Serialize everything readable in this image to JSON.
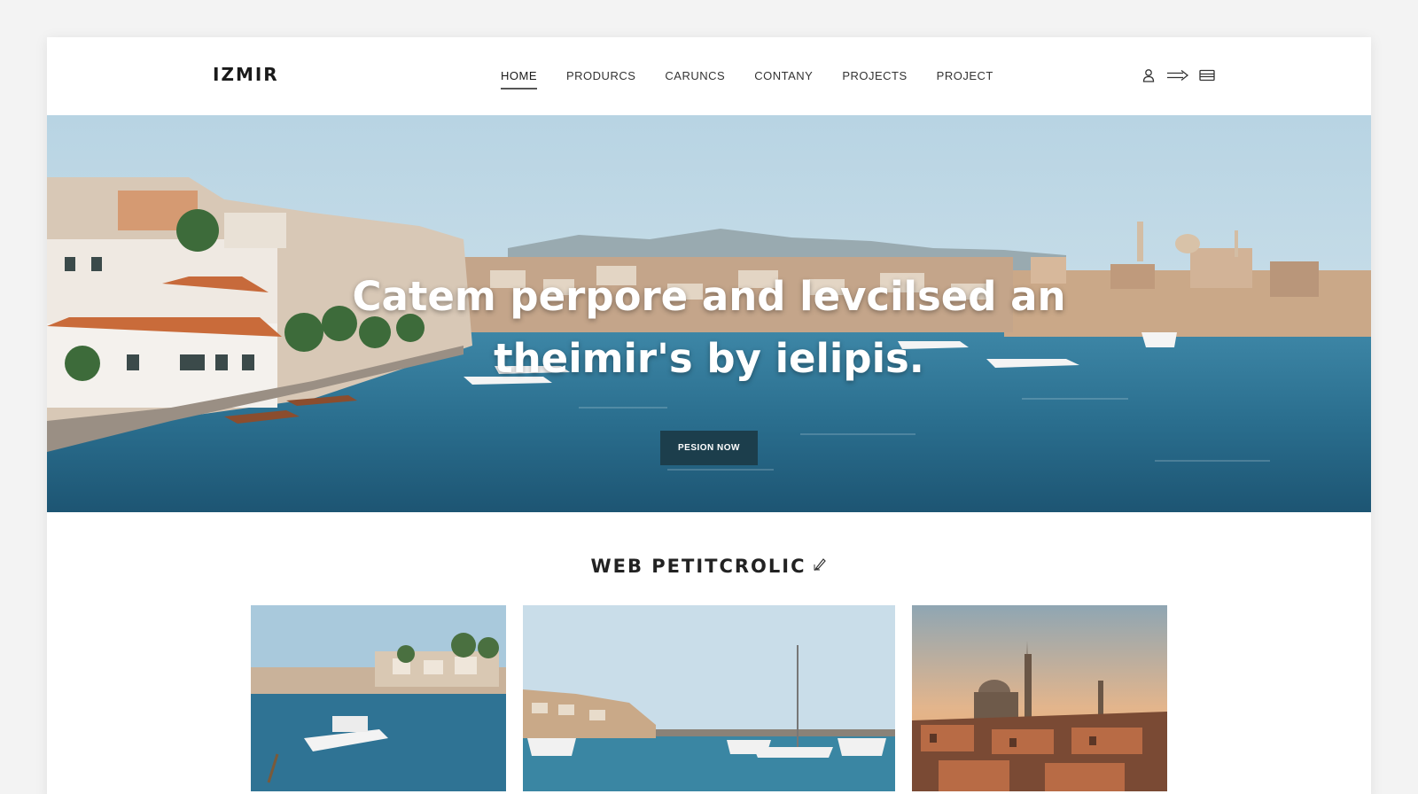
{
  "header": {
    "logo": "IZMIR",
    "nav": [
      {
        "label": "HOME",
        "active": true
      },
      {
        "label": "PRODURCS",
        "active": false
      },
      {
        "label": "CARUNCS",
        "active": false
      },
      {
        "label": "CONTANY",
        "active": false
      },
      {
        "label": "PROJECTS",
        "active": false
      },
      {
        "label": "PROJECT",
        "active": false
      }
    ],
    "icons": [
      "user-icon",
      "arrow-right-icon",
      "card-icon"
    ]
  },
  "hero": {
    "title_line1": "Catem perpore and levcilsed an",
    "title_line2": "theimir's by ielipis.",
    "cta_label": "PESION NOW"
  },
  "section": {
    "title": "WEB PETITCROLIC",
    "title_icon": "pen-icon"
  },
  "colors": {
    "accent": "#1c3e4c",
    "sky": "#b9d6e6",
    "sea": "#2b6f8f"
  }
}
